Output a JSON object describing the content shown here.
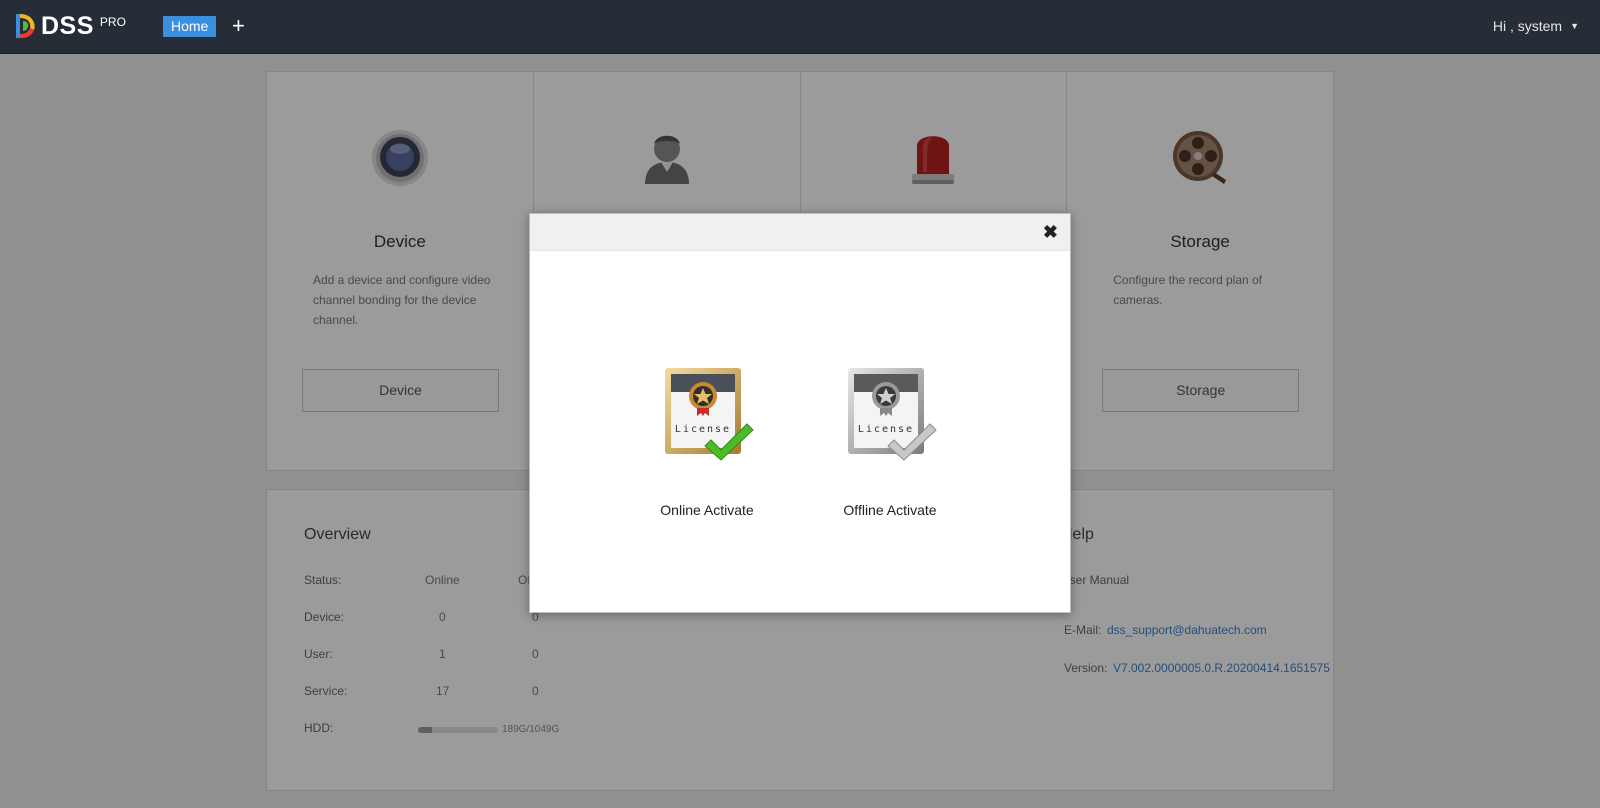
{
  "header": {
    "logo_text": "DSS",
    "logo_sup": "PRO",
    "home_tab": "Home",
    "add_tab": "+",
    "user_greeting": "Hi , system",
    "user_caret": "▼"
  },
  "cards": [
    {
      "title": "Device",
      "desc": "Add a device and configure video channel bonding for the device channel.",
      "button": "Device",
      "icon": "camera-lens-icon"
    },
    {
      "title": "",
      "desc": "",
      "button": "",
      "icon": "user-icon"
    },
    {
      "title": "",
      "desc": "",
      "button": "",
      "icon": "alarm-siren-icon"
    },
    {
      "title": "Storage",
      "desc": "Configure the record plan of cameras.",
      "button": "Storage",
      "icon": "film-reel-icon"
    }
  ],
  "overview": {
    "title": "Overview",
    "status_label": "Status:",
    "online_label": "Online",
    "offline_label_partial": "Of",
    "rows": [
      {
        "label": "Device:",
        "online": "0",
        "offline": "0"
      },
      {
        "label": "User:",
        "online": "1",
        "offline": "0"
      },
      {
        "label": "Service:",
        "online": "17",
        "offline": "0"
      }
    ],
    "hdd_label": "HDD:",
    "hdd_text": "189G/1049G",
    "hdd_used_fraction": 0.18
  },
  "help": {
    "title": "Help",
    "manual": "User Manual",
    "email_label": "E-Mail:",
    "email": "dss_support@dahuatech.com",
    "version_label": "Version:",
    "version": "V7.002.0000005.0.R.20200414.1651575"
  },
  "modal": {
    "close": "✖",
    "online_label": "Online Activate",
    "offline_label": "Offline Activate",
    "license_word": "License"
  },
  "colors": {
    "topbar": "#262d36",
    "accent": "#3a8fde",
    "link": "#3a7fc8",
    "check_green": "#4cbb2a"
  }
}
